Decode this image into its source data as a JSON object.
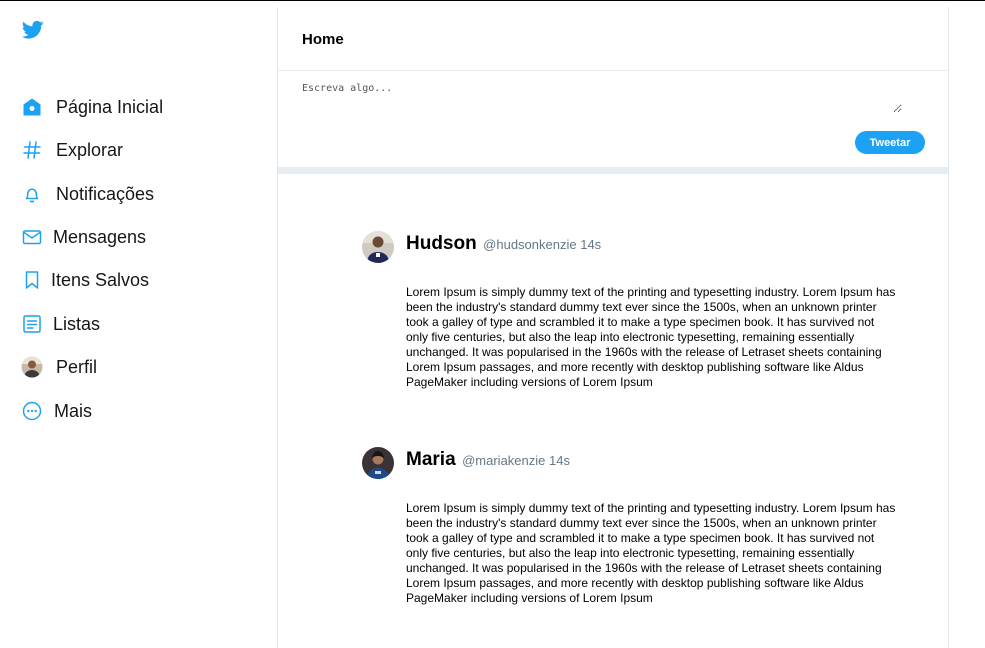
{
  "colors": {
    "brand": "#1da1f2",
    "divider": "#e6ecf0",
    "muted": "#657786"
  },
  "logo": {
    "icon": "twitter-bird-icon"
  },
  "sidebar": {
    "items": [
      {
        "label": "Página Inicial",
        "icon": "home-icon"
      },
      {
        "label": "Explorar",
        "icon": "hashtag-icon"
      },
      {
        "label": "Notificações",
        "icon": "bell-icon"
      },
      {
        "label": "Mensagens",
        "icon": "mail-icon"
      },
      {
        "label": "Itens Salvos",
        "icon": "bookmark-icon"
      },
      {
        "label": "Listas",
        "icon": "list-icon"
      },
      {
        "label": "Perfil",
        "icon": "profile-avatar-icon"
      },
      {
        "label": "Mais",
        "icon": "more-icon"
      }
    ]
  },
  "header": {
    "title": "Home"
  },
  "compose": {
    "placeholder": "Escreva algo...",
    "button_label": "Tweetar"
  },
  "tweets": [
    {
      "name": "Hudson",
      "meta": "@hudsonkenzie 14s",
      "text": "Lorem Ipsum is simply dummy text of the printing and typesetting industry. Lorem Ipsum has been the industry's standard dummy text ever since the 1500s, when an unknown printer took a galley of type and scrambled it to make a type specimen book. It has survived not only five centuries, but also the leap into electronic typesetting, remaining essentially unchanged. It was popularised in the 1960s with the release of Letraset sheets containing Lorem Ipsum passages, and more recently with desktop publishing software like Aldus PageMaker including versions of Lorem Ipsum"
    },
    {
      "name": "Maria",
      "meta": "@mariakenzie 14s",
      "text": "Lorem Ipsum is simply dummy text of the printing and typesetting industry. Lorem Ipsum has been the industry's standard dummy text ever since the 1500s, when an unknown printer took a galley of type and scrambled it to make a type specimen book. It has survived not only five centuries, but also the leap into electronic typesetting, remaining essentially unchanged. It was popularised in the 1960s with the release of Letraset sheets containing Lorem Ipsum passages, and more recently with desktop publishing software like Aldus PageMaker including versions of Lorem Ipsum"
    }
  ]
}
